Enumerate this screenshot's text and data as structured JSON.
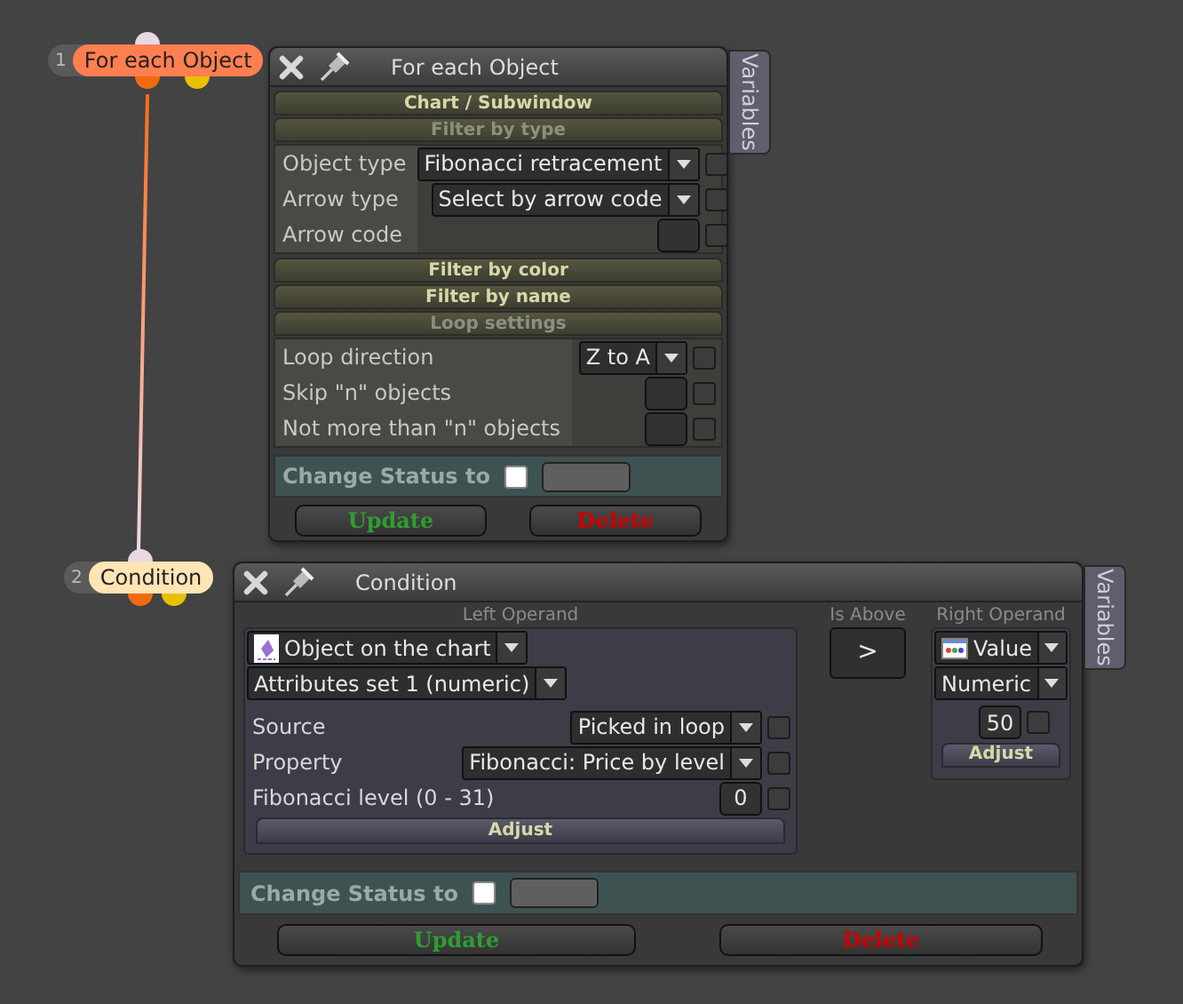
{
  "nodes": [
    {
      "number": "1",
      "label": "For each Object",
      "color": "#ff7f50"
    },
    {
      "number": "2",
      "label": "Condition",
      "color": "#ffe4b5"
    }
  ],
  "loop_panel": {
    "title": "For each Object",
    "side_tab": "Variables",
    "sections": [
      {
        "title": "Chart / Subwindow",
        "expanded": false
      },
      {
        "title": "Filter by type",
        "expanded": true,
        "rows": [
          {
            "label": "Object type",
            "kind": "dropdown",
            "value": "Fibonacci retracement",
            "checked": false
          },
          {
            "label": "Arrow type",
            "kind": "dropdown",
            "value": "Select by arrow code",
            "checked": false
          },
          {
            "label": "Arrow code",
            "kind": "number",
            "checked": false
          }
        ]
      },
      {
        "title": "Filter by color",
        "expanded": false
      },
      {
        "title": "Filter by name",
        "expanded": false
      },
      {
        "title": "Loop settings",
        "expanded": true,
        "rows": [
          {
            "label": "Loop direction",
            "kind": "dropdown",
            "value": "Z to A",
            "checked": false
          },
          {
            "label": "Skip \"n\" objects",
            "kind": "number",
            "checked": false
          },
          {
            "label": "Not more than \"n\" objects",
            "kind": "number",
            "checked": false
          }
        ]
      }
    ],
    "status": {
      "label": "Change Status to",
      "checked": false
    },
    "buttons": [
      {
        "label": "Update",
        "kind": "update"
      },
      {
        "label": "Delete",
        "kind": "delete"
      }
    ]
  },
  "condition_panel": {
    "title": "Condition",
    "side_tab": "Variables",
    "left_operand": {
      "caption": "Left Operand",
      "source": "Object on the chart",
      "attributes": "Attributes set 1 (numeric)",
      "rows": [
        {
          "label": "Source",
          "kind": "dropdown",
          "value": "Picked in loop",
          "checked": false
        },
        {
          "label": "Property",
          "kind": "dropdown",
          "value": "Fibonacci: Price by level",
          "checked": false
        },
        {
          "label": "Fibonacci level (0 - 31)",
          "kind": "number",
          "value": "0",
          "checked": false
        }
      ],
      "adjust": "Adjust"
    },
    "operator": {
      "caption": "Is Above",
      "value": ">"
    },
    "right_operand": {
      "caption": "Right Operand",
      "source": "Value",
      "type": "Numeric",
      "value": "50",
      "checked": false,
      "adjust": "Adjust"
    },
    "status": {
      "label": "Change Status to",
      "checked": false
    },
    "buttons": [
      {
        "label": "Update",
        "kind": "update"
      },
      {
        "label": "Delete",
        "kind": "delete"
      }
    ]
  }
}
